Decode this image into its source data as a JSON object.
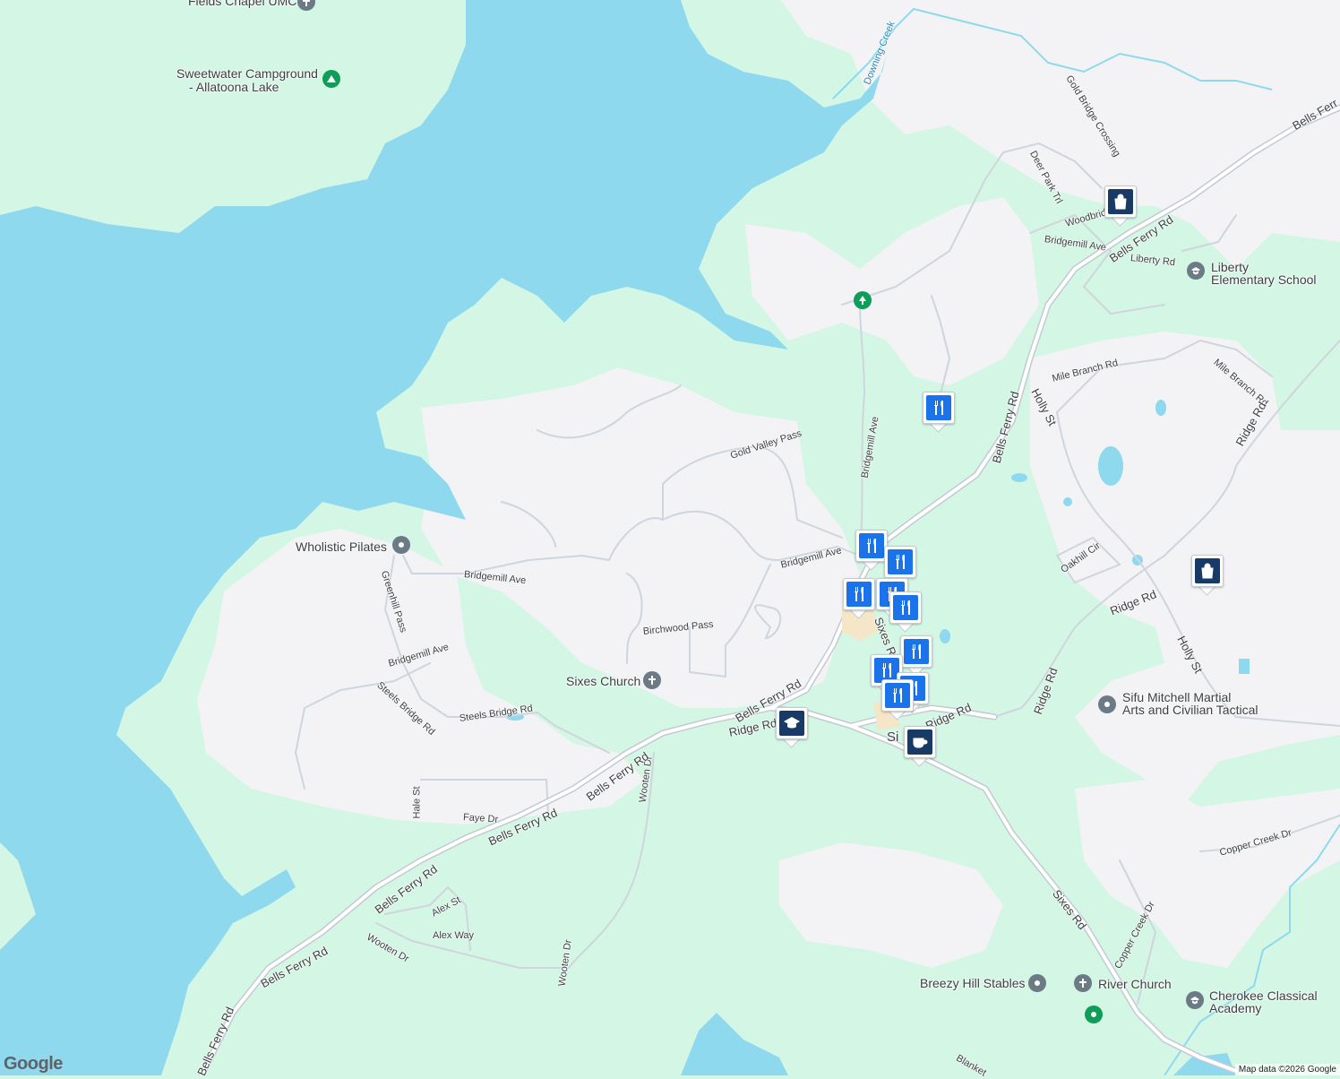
{
  "map": {
    "attribution": "Map data ©2026 Google",
    "logo": "Google",
    "colors": {
      "land": "#d4f6e4",
      "urban": "#f3f3f5",
      "water": "#8ed9ee",
      "road": "#ffffff",
      "road_outline": "#cfd5dc",
      "highway": "#c4cad3",
      "poi_pin": "#1a73e8",
      "poi_dark": "#183a66",
      "park_green": "#0f9d58",
      "poi_gray": "#6c7a86"
    }
  },
  "places": {
    "fields_chapel": "Fields Chapel UMC",
    "sweetwater_1": "Sweetwater Campground",
    "sweetwater_2": "- Allatoona Lake",
    "wholistic_pilates": "Wholistic Pilates",
    "sixes_church": "Sixes Church",
    "liberty_1": "Liberty",
    "liberty_2": "Elementary School",
    "sifu_1": "Sifu Mitchell Martial",
    "sifu_2": "Arts and Civilian Tactical",
    "breezy_hill": "Breezy Hill Stables",
    "river_church": "River Church",
    "cherokee_1": "Cherokee Classical",
    "cherokee_2": "Academy",
    "sixes_town": "Si"
  },
  "roads": {
    "downing_creek": "Downing Creek",
    "gold_bridge_crossing": "Gold Bridge Crossing",
    "deer_park_trl": "Deer Park Trl",
    "woodbridge_ln": "Woodbridge Ln",
    "bridgemill_ave_ne": "Bridgemill Ave",
    "bells_ferry_ne": "Bells Ferry Rd",
    "bells_ferry_top": "Bells Ferr",
    "liberty_rd": "Liberty Rd",
    "mile_branch_rd": "Mile Branch Rd",
    "mile_branch_rd_2": "Mile Branch Rd",
    "holly_st": "Holly St",
    "holly_st_2": "Holly St",
    "bells_ferry_mid": "Bells Ferry Rd",
    "ridge_rd_ne": "Ridge Rd",
    "gold_valley_pass": "Gold Valley Pass",
    "bridgemill_ave_n": "Bridgemill Ave",
    "bridgemill_ave_center": "Bridgemill Ave",
    "oakhill_cir": "Oakhill Cir",
    "ridge_rd_e": "Ridge Rd",
    "ridge_rd_e2": "Ridge Rd",
    "bridgemill_ave_w": "Bridgemill Ave",
    "greenhill_pass": "Greenhill Pass",
    "birchwood_pass": "Birchwood Pass",
    "sixes_rd_n": "Sixes Rd",
    "bridgemill_ave_sw": "Bridgemill Ave",
    "steels_bridge_rd": "Steels Bridge Rd",
    "steels_bridge_rd_2": "Steels Bridge Rd",
    "bells_ferry_sixes": "Bells Ferry Rd",
    "ridge_rd_center": "Ridge Rd",
    "ridge_rd_sixes": "Ridge Rd",
    "wooten_dr": "Wooten Dr",
    "bells_ferry_sw1": "Bells Ferry Rd",
    "hale_st": "Hale St",
    "faye_dr": "Faye Dr",
    "bells_ferry_sw2": "Bells Ferry Rd",
    "bells_ferry_sw3": "Bells Ferry Rd",
    "alex_st": "Alex St",
    "alex_way": "Alex Way",
    "wooten_dr_sw": "Wooten Dr",
    "wooten_dr_s": "Wooten Dr",
    "bells_ferry_sw4": "Bells Ferry Rd",
    "bells_ferry_bottom": "Bells Ferry Rd",
    "sixes_rd_s": "Sixes Rd",
    "copper_creek_dr": "Copper Creek Dr",
    "copper_creek_dr_2": "Copper Creek Dr",
    "blankets": "Blanket"
  },
  "pins": [
    {
      "type": "shopping",
      "icon": "shopping-bag-icon"
    },
    {
      "type": "restaurant",
      "icon": "fork-knife-icon"
    },
    {
      "type": "restaurant",
      "icon": "fork-knife-icon"
    },
    {
      "type": "restaurant",
      "icon": "fork-knife-icon"
    },
    {
      "type": "restaurant",
      "icon": "fork-knife-icon"
    },
    {
      "type": "restaurant",
      "icon": "fork-knife-icon"
    },
    {
      "type": "restaurant",
      "icon": "fork-knife-icon"
    },
    {
      "type": "restaurant",
      "icon": "fork-knife-icon"
    },
    {
      "type": "restaurant",
      "icon": "fork-knife-icon"
    },
    {
      "type": "restaurant",
      "icon": "fork-knife-icon"
    },
    {
      "type": "restaurant",
      "icon": "fork-knife-icon"
    },
    {
      "type": "shopping",
      "icon": "shopping-bag-icon"
    },
    {
      "type": "school",
      "icon": "graduation-cap-icon"
    },
    {
      "type": "cafe",
      "icon": "coffee-cup-icon"
    }
  ]
}
